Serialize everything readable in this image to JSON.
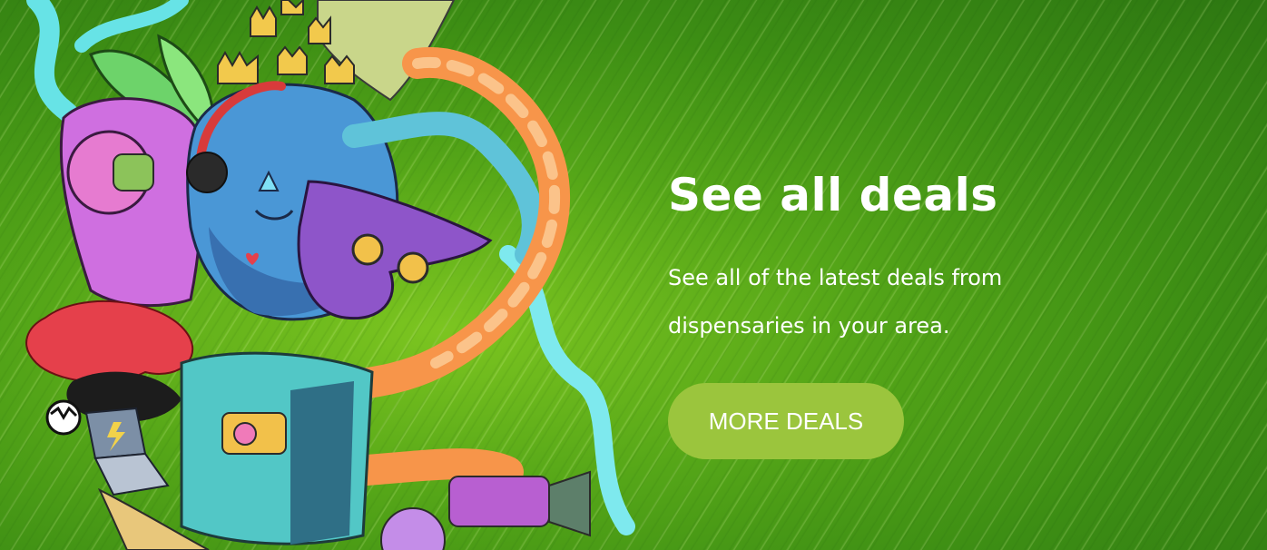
{
  "banner": {
    "headline": "See all deals",
    "description": "See all of the latest deals from dispensaries in your area.",
    "cta_label": "MORE DEALS"
  },
  "colors": {
    "button_background": "#9bc53d",
    "text": "#ffffff",
    "background": "#55a618"
  },
  "illustration": {
    "subject": "psychedelic-cartoon-creature-artwork"
  }
}
